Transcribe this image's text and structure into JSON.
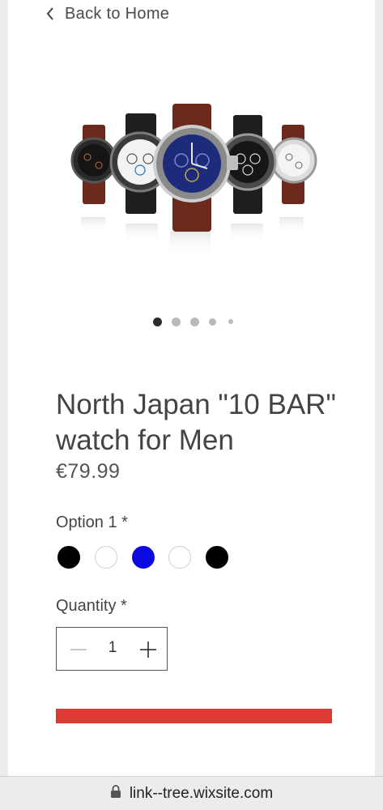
{
  "nav": {
    "back_label": "Back to Home",
    "back_icon": "chevron-left-icon"
  },
  "gallery": {
    "image": "watches-product-image",
    "slide_count": 5,
    "active_slide": 1
  },
  "product": {
    "title": "North Japan \"10 BAR\" watch for Men",
    "price": "€79.99"
  },
  "options": {
    "label": "Option 1 *",
    "swatches": [
      {
        "name": "black",
        "color": "#000000",
        "selected": false
      },
      {
        "name": "white",
        "color": "#ffffff",
        "selected": false
      },
      {
        "name": "blue",
        "color": "#0a0ae0",
        "selected": false
      },
      {
        "name": "white",
        "color": "#ffffff",
        "selected": false
      },
      {
        "name": "black",
        "color": "#000000",
        "selected": false
      }
    ]
  },
  "quantity": {
    "label": "Quantity *",
    "value": "1"
  },
  "theme": {
    "accent": "#dd3a34"
  },
  "browser": {
    "url": "link--tree.wixsite.com",
    "lock_icon": "lock-icon"
  }
}
